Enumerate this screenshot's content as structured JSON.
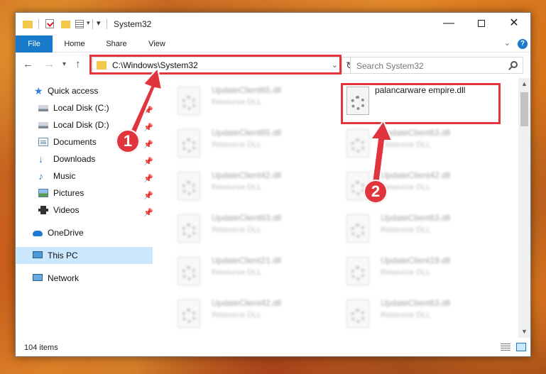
{
  "window": {
    "title": "System32",
    "minimize_label": "—",
    "close_label": "✕"
  },
  "ribbon": {
    "tabs": [
      {
        "label": "File"
      },
      {
        "label": "Home"
      },
      {
        "label": "Share"
      },
      {
        "label": "View"
      }
    ],
    "help_label": "?"
  },
  "navbar": {
    "address": "C:\\Windows\\System32",
    "search_placeholder": "Search System32"
  },
  "sidebar": {
    "quick_access": "Quick access",
    "items": [
      {
        "label": "Local Disk (C:)",
        "icon": "hard-drive-icon",
        "pinned": true
      },
      {
        "label": "Local Disk (D:)",
        "icon": "hard-drive-icon",
        "pinned": true
      },
      {
        "label": "Documents",
        "icon": "documents-icon",
        "pinned": true
      },
      {
        "label": "Downloads",
        "icon": "downloads-icon",
        "pinned": true
      },
      {
        "label": "Music",
        "icon": "music-icon",
        "pinned": true
      },
      {
        "label": "Pictures",
        "icon": "pictures-icon",
        "pinned": true
      },
      {
        "label": "Videos",
        "icon": "videos-icon",
        "pinned": true
      }
    ],
    "onedrive": "OneDrive",
    "this_pc": "This PC",
    "network": "Network"
  },
  "files": {
    "left_column": [
      {
        "name": "UpdateClient65.dll",
        "type": "Resource DLL"
      },
      {
        "name": "UpdateClient65.dll",
        "type": "Resource DLL"
      },
      {
        "name": "UpdateClient42.dll",
        "type": "Resource DLL"
      },
      {
        "name": "UpdateClient63.dll",
        "type": "Resource DLL"
      },
      {
        "name": "UpdateClient21.dll",
        "type": "Resource DLL"
      },
      {
        "name": "UpdateClient42.dll",
        "type": "Resource DLL"
      }
    ],
    "right_column": [
      {
        "name": "palancarware empire.dll",
        "type": ""
      },
      {
        "name": "UpdateClient63.dll",
        "type": "Resource DLL"
      },
      {
        "name": "UpdateClient42.dll",
        "type": "Resource DLL"
      },
      {
        "name": "UpdateClient63.dll",
        "type": "Resource DLL"
      },
      {
        "name": "UpdateClient19.dll",
        "type": "Resource DLL"
      },
      {
        "name": "UpdateClient63.dll",
        "type": "Resource DLL"
      }
    ]
  },
  "statusbar": {
    "item_count": "104 items"
  },
  "annotations": {
    "step1": "1",
    "step2": "2",
    "highlight_color": "#e0353c"
  },
  "colors": {
    "accent": "#1979ca",
    "selection": "#cce8ff"
  }
}
